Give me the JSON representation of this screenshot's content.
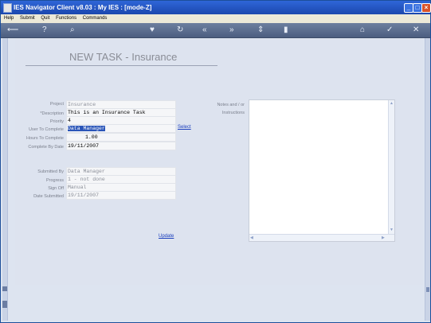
{
  "window": {
    "title": "IES Navigator Client v8.03 : My IES :      [mode-Z]"
  },
  "menu": {
    "items": [
      "Help",
      "Submit",
      "Quit",
      "Functions",
      "Commands"
    ]
  },
  "toolbar": {
    "icons": [
      "back-arrow-icon",
      "help-icon",
      "search-icon",
      "heart-icon",
      "refresh-icon",
      "first-icon",
      "last-icon",
      "expand-icon",
      "document-icon",
      "home-icon",
      "check-icon",
      "close-icon"
    ]
  },
  "page": {
    "title": "NEW TASK - Insurance"
  },
  "form": {
    "project": {
      "label": "Project",
      "value": "Insurance"
    },
    "description": {
      "label": "*Description",
      "value": "This is an Insurance Task"
    },
    "priority": {
      "label": "Priority",
      "value": "4"
    },
    "user_to_complete": {
      "label": "User To Complete",
      "value": "Data Manager",
      "link": "Select"
    },
    "hours_to_complete": {
      "label": "Hours To Complete",
      "value": "1.00"
    },
    "complete_by_date": {
      "label": "Complete By Date",
      "value": "19/11/2007"
    },
    "submitted_by": {
      "label": "Submitted By",
      "value": "Data Manager"
    },
    "progress": {
      "label": "Progress",
      "value": "1 - not done"
    },
    "sign_off": {
      "label": "Sign Off",
      "value": "Manual"
    },
    "date_submitted": {
      "label": "Date Submitted",
      "value": "19/11/2007"
    },
    "notes_label_1": "Notes and / or",
    "notes_label_2": "Instructions",
    "update_link": "Update"
  },
  "colors": {
    "titlebar": "#2f66d8",
    "toolbar": "#5a6c8e",
    "link": "#1b3fbd",
    "highlight": "#2a55b8"
  }
}
